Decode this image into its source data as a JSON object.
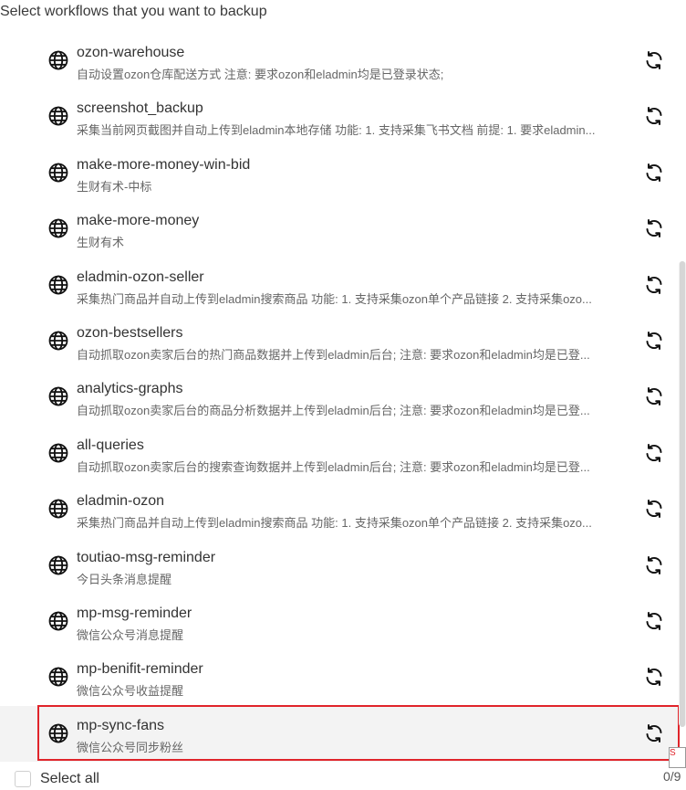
{
  "header": {
    "title": "Select workflows that you want to backup"
  },
  "workflows": [
    {
      "name": "ozon-warehouse",
      "description": "自动设置ozon仓库配送方式 注意: 要求ozon和eladmin均是已登录状态;"
    },
    {
      "name": "screenshot_backup",
      "description": "采集当前网页截图并自动上传到eladmin本地存储 功能: 1. 支持采集飞书文档 前提: 1. 要求eladmin..."
    },
    {
      "name": "make-more-money-win-bid",
      "description": "生财有术-中标"
    },
    {
      "name": "make-more-money",
      "description": "生财有术"
    },
    {
      "name": "eladmin-ozon-seller",
      "description": "采集热门商品并自动上传到eladmin搜索商品 功能: 1. 支持采集ozon单个产品链接 2. 支持采集ozo..."
    },
    {
      "name": "ozon-bestsellers",
      "description": "自动抓取ozon卖家后台的热门商品数据并上传到eladmin后台; 注意: 要求ozon和eladmin均是已登..."
    },
    {
      "name": "analytics-graphs",
      "description": "自动抓取ozon卖家后台的商品分析数据并上传到eladmin后台; 注意: 要求ozon和eladmin均是已登..."
    },
    {
      "name": "all-queries",
      "description": "自动抓取ozon卖家后台的搜索查询数据并上传到eladmin后台; 注意: 要求ozon和eladmin均是已登..."
    },
    {
      "name": "eladmin-ozon",
      "description": "采集热门商品并自动上传到eladmin搜索商品 功能: 1. 支持采集ozon单个产品链接 2. 支持采集ozo..."
    },
    {
      "name": "toutiao-msg-reminder",
      "description": "今日头条消息提醒"
    },
    {
      "name": "mp-msg-reminder",
      "description": "微信公众号消息提醒"
    },
    {
      "name": "mp-benifit-reminder",
      "description": "微信公众号收益提醒"
    },
    {
      "name": "mp-sync-fans",
      "description": "微信公众号同步粉丝",
      "highlighted": true
    }
  ],
  "icons": {
    "workflow": "globe-icon",
    "action": "sync-icon"
  },
  "footer": {
    "select_all_label": "Select all",
    "count": "0/9",
    "corner_fragment": "S"
  },
  "colors": {
    "highlight_border": "#e0242a"
  }
}
